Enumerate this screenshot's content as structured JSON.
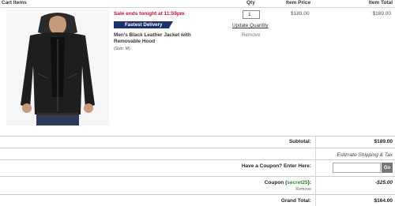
{
  "header": {
    "cart_items": "Cart Items",
    "qty": "Qty",
    "item_price": "Item Price",
    "item_total": "Item Total"
  },
  "item": {
    "sale_text": "Sale ends tonight at 11:59pm",
    "badge": "Fastest Delivery",
    "name": "Men's Black Leather Jacket with Removable Hood",
    "size": "(Size: M)",
    "qty_value": "1",
    "update_label": "Update Quantity",
    "remove_label": "Remove",
    "price": "$189.00",
    "total": "$189.00",
    "image_icon": "black-leather-jacket-photo"
  },
  "summary": {
    "subtotal_label": "Subtotal:",
    "subtotal_value": "$189.00",
    "estimate_label": "Estimate Shipping & Tax",
    "coupon_prompt": "Have a Coupon? Enter Here:",
    "go_label": "Go",
    "coupon_label_prefix": "Coupon (",
    "coupon_code": "secret25",
    "coupon_label_suffix": "):",
    "coupon_value": "-$25.00",
    "coupon_remove": "Remove",
    "grand_total_label": "Grand Total:",
    "grand_total_value": "$164.00"
  },
  "colors": {
    "sale": "#c8102e",
    "badge_bg": "#1f2f6b",
    "coupon_code": "#2a8a2a",
    "go_button": "#777777"
  }
}
